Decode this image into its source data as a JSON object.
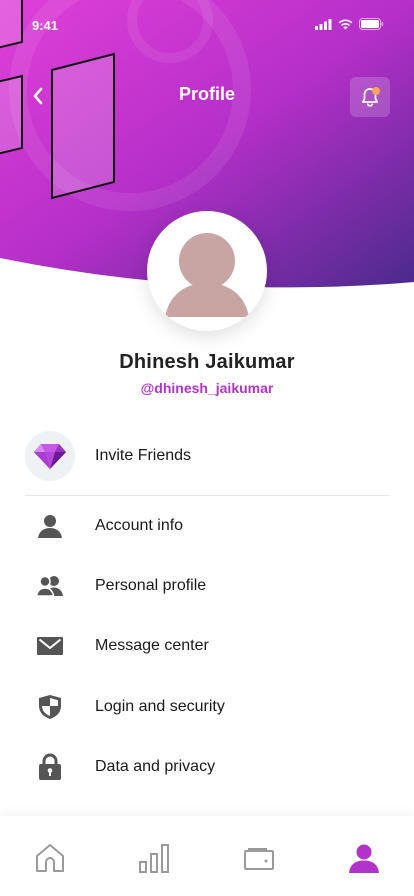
{
  "status_bar": {
    "time": "9:41"
  },
  "header": {
    "title": "Profile"
  },
  "profile": {
    "name": "Dhinesh Jaikumar",
    "handle": "@dhinesh_jaikumar"
  },
  "invite": {
    "label": "Invite Friends",
    "icon": "gem-icon"
  },
  "menu": [
    {
      "label": "Account info",
      "icon": "user-icon"
    },
    {
      "label": "Personal profile",
      "icon": "users-icon"
    },
    {
      "label": "Message center",
      "icon": "envelope-icon"
    },
    {
      "label": "Login and security",
      "icon": "shield-icon"
    },
    {
      "label": "Data and privacy",
      "icon": "lock-icon"
    }
  ],
  "tabs": [
    {
      "icon": "home-icon",
      "active": false
    },
    {
      "icon": "bar-chart-icon",
      "active": false
    },
    {
      "icon": "wallet-icon",
      "active": false
    },
    {
      "icon": "profile-icon",
      "active": true
    }
  ],
  "colors": {
    "accent": "#b233c9",
    "header_gradient_start": "#d93ad6",
    "header_gradient_end": "#4e2a8f",
    "icon_gray": "#555555",
    "notification_dot": "#f7a25b"
  }
}
